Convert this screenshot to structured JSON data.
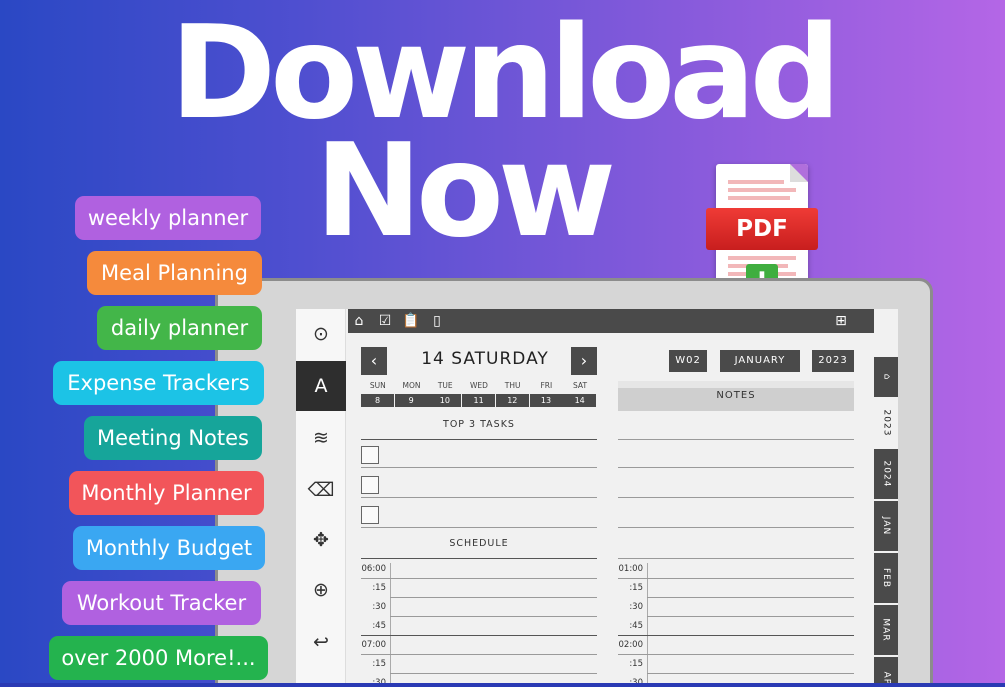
{
  "headline": {
    "line1": "Download",
    "line2": "Now"
  },
  "pdf_badge": {
    "label": "PDF",
    "arrow": "⬇"
  },
  "pills": [
    {
      "label": "weekly planner",
      "color": "#b061e0"
    },
    {
      "label": "Meal Planning",
      "color": "#f58a3c"
    },
    {
      "label": "daily planner",
      "color": "#43b649"
    },
    {
      "label": "Expense Trackers",
      "color": "#1cc3e6"
    },
    {
      "label": "Meeting Notes",
      "color": "#16a59a"
    },
    {
      "label": "Monthly Planner",
      "color": "#f2555a"
    },
    {
      "label": "Monthly Budget",
      "color": "#3aa7f2"
    },
    {
      "label": "Workout Tracker",
      "color": "#b061e0"
    },
    {
      "label": "over 2000 More!...",
      "color": "#24b34e"
    }
  ],
  "planner": {
    "day_title": "14 SATURDAY",
    "prev": "‹",
    "next": "›",
    "week": "W02",
    "month": "JANUARY",
    "year": "2023",
    "weekdays": [
      "SUN",
      "MON",
      "TUE",
      "WED",
      "THU",
      "FRI",
      "SAT"
    ],
    "dates": [
      "8",
      "9",
      "10",
      "11",
      "12",
      "13",
      "14"
    ],
    "top3_title": "TOP 3 TASKS",
    "schedule_title": "SCHEDULE",
    "notes_title": "NOTES",
    "schedule_left": [
      "06:00",
      ":15",
      ":30",
      ":45",
      "07:00",
      ":15",
      ":30"
    ],
    "schedule_right": [
      "01:00",
      ":15",
      ":30",
      ":45",
      "02:00",
      ":15",
      ":30"
    ],
    "side_tabs": [
      "2023",
      "2024",
      "JAN",
      "FEB",
      "MAR",
      "APR"
    ],
    "tools": [
      {
        "name": "pen-tool-icon",
        "glyph": "⊙"
      },
      {
        "name": "text-tool-icon",
        "glyph": "A"
      },
      {
        "name": "lines-tool-icon",
        "glyph": "≋"
      },
      {
        "name": "eraser-icon",
        "glyph": "⌫"
      },
      {
        "name": "move-icon",
        "glyph": "✥"
      },
      {
        "name": "zoom-icon",
        "glyph": "⊕"
      },
      {
        "name": "undo-icon",
        "glyph": "↩"
      }
    ],
    "top_icons": [
      {
        "name": "home-icon",
        "glyph": "⌂"
      },
      {
        "name": "checkbox-icon",
        "glyph": "☑"
      },
      {
        "name": "clipboard-icon",
        "glyph": "📋"
      },
      {
        "name": "document-icon",
        "glyph": "▯"
      }
    ],
    "layout_icon": "⊞"
  }
}
